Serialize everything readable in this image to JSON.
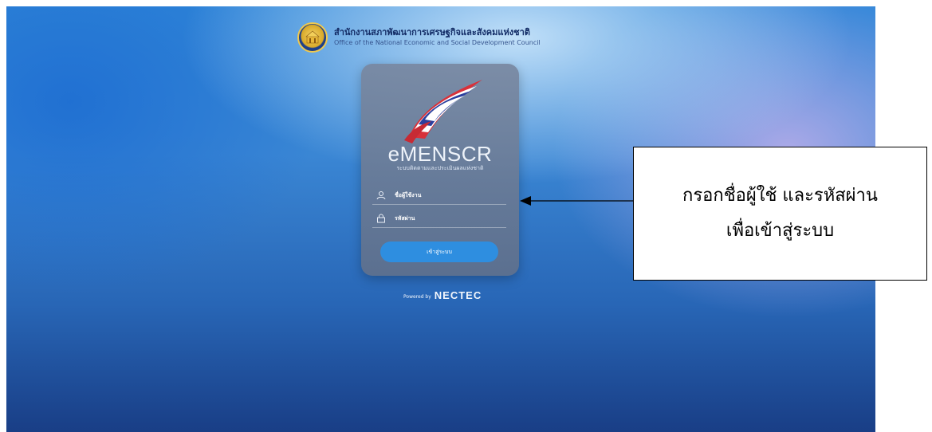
{
  "org": {
    "name_th": "สำนักงานสภาพัฒนาการเศรษฐกิจและสังคมแห่งชาติ",
    "name_en": "Office of the National Economic and Social Development Council"
  },
  "login": {
    "app_name": "eMENSCR",
    "app_subtitle": "ระบบติดตามและประเมินผลแห่งชาติ",
    "username_label": "ชื่อผู้ใช้งาน",
    "password_label": "รหัสผ่าน",
    "login_button": "เข้าสู่ระบบ"
  },
  "footer": {
    "powered_by": "Powered by",
    "brand": "NECTEC"
  },
  "annotation": {
    "line1": "กรอกชื่อผู้ใช้ และรหัสผ่าน",
    "line2": "เพื่อเข้าสู่ระบบ"
  },
  "icons": [
    "nesdc-seal-icon",
    "emenscr-logo-icon",
    "user-icon",
    "lock-icon",
    "arrow-left-icon"
  ]
}
